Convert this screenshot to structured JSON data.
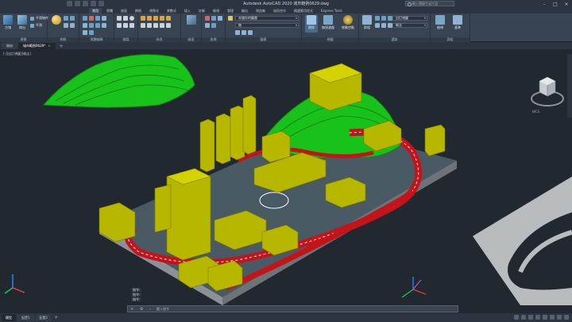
{
  "app": {
    "title": "Autodesk AutoCAD 2020   城市範例0629.dwg",
    "search_placeholder": "輸入關鍵字或片語"
  },
  "ribbon_tabs": [
    "常用",
    "實體",
    "曲面",
    "網格",
    "視覺化",
    "參數式",
    "插入",
    "註解",
    "檢視",
    "管理",
    "輸出",
    "增益集",
    "協同合作",
    "精選應用程式",
    "Express Tools"
  ],
  "ribbon_active_tab": 0,
  "ribbon": {
    "panels": [
      {
        "label": "建模",
        "big_buttons": [
          "方塊",
          "擠出"
        ]
      },
      {
        "label": "網格",
        "small_buttons": [
          "平滑物件",
          "平滑"
        ]
      },
      {
        "label": "實體編輯"
      },
      {
        "label": "繪製"
      },
      {
        "label": "修改"
      },
      {
        "label": "斷面"
      },
      {
        "label": "座標"
      },
      {
        "label": "圖層"
      },
      {
        "label": "視圖"
      },
      {
        "label": "選取"
      },
      {
        "label": "群組"
      }
    ],
    "layer_dropdown": "未儲存的圖層",
    "viewport_dropdown": "無",
    "visual_style": "概念",
    "view_dropdown": "自訂視圖",
    "buttons": {
      "culling": "剔除",
      "no_filter": "無過濾器",
      "move_gizmo": "移動控點",
      "group": "群組",
      "view": "檢視",
      "base": "基準"
    }
  },
  "doc_tabs": [
    "開始",
    "城市範例0629*"
  ],
  "doc_active_tab": 1,
  "viewport_label": "[-][自訂視圖][概念]",
  "viewcube": {
    "label": "WCS"
  },
  "command_history": [
    "指令:",
    "指令:",
    "指令:"
  ],
  "command_placeholder": "鍵入指令",
  "status_tabs": [
    "模型",
    "配置1",
    "配置2"
  ],
  "status_active_tab": 0,
  "colors": {
    "background": "#212830",
    "ribbon": "#384452",
    "building": "#b8b700",
    "hill": "#18c21a",
    "road_red": "#c4141a",
    "base_plate": "#4a5a65"
  }
}
